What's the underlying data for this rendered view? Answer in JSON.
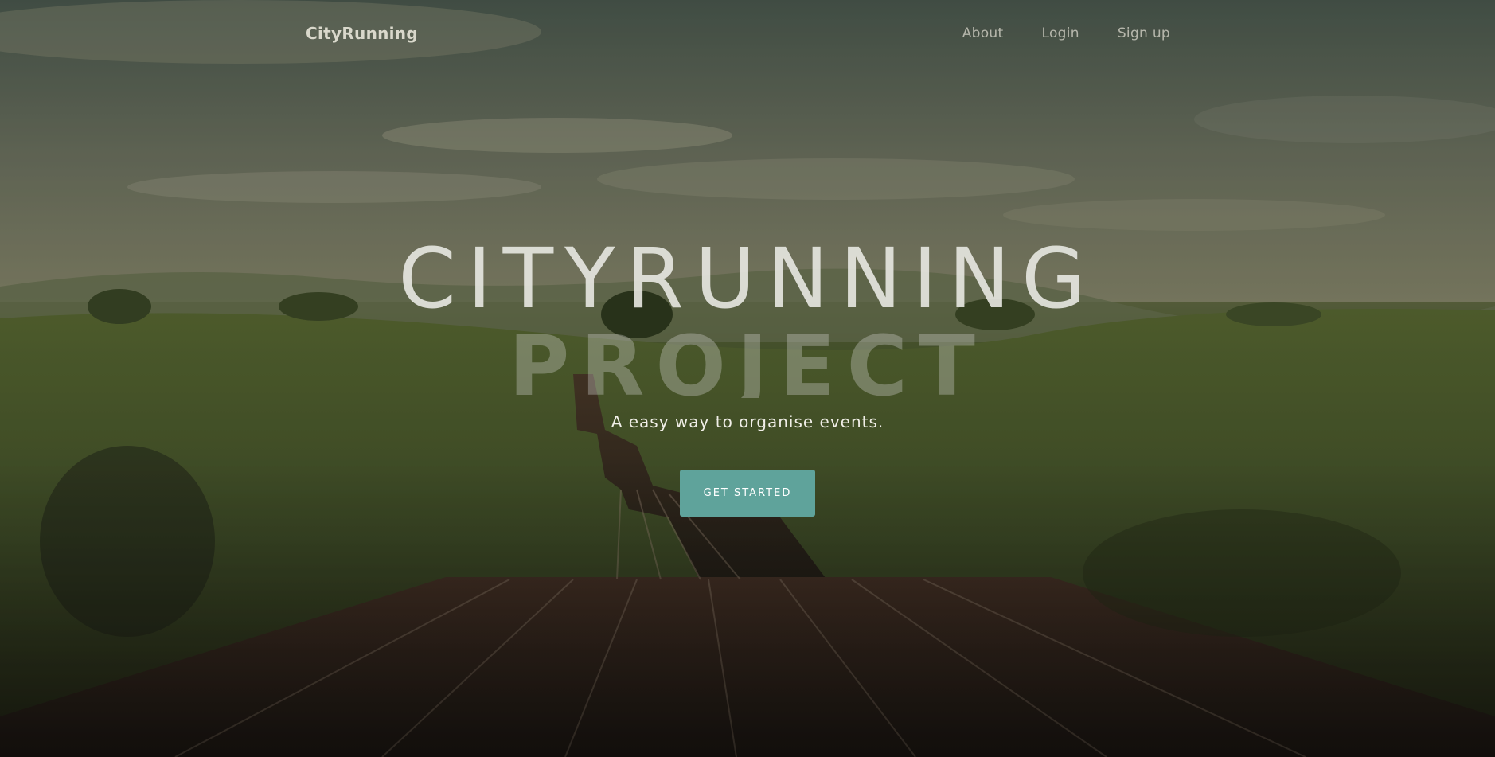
{
  "navbar": {
    "brand": "CityRunning",
    "links": [
      {
        "label": "About"
      },
      {
        "label": "Login"
      },
      {
        "label": "Sign up"
      }
    ]
  },
  "hero": {
    "title_line_1": "CITYRUNNING",
    "title_line_2": "PROJECT",
    "tagline": "A easy way to organise events.",
    "cta_label": "GET STARTED",
    "background_image": "countryside landscape with running track road"
  },
  "colors": {
    "accent": "#5fa39b",
    "text_light": "#f1efe8"
  }
}
